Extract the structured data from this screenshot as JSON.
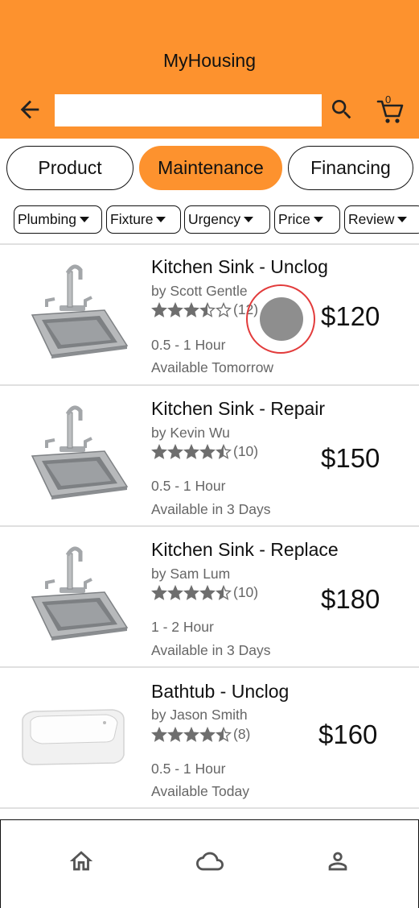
{
  "app": {
    "title": "MyHousing"
  },
  "search": {
    "value": "",
    "placeholder": ""
  },
  "cart": {
    "count": "0"
  },
  "tabs": [
    {
      "label": "Product",
      "active": false
    },
    {
      "label": "Maintenance",
      "active": true
    },
    {
      "label": "Financing",
      "active": false
    }
  ],
  "filters": [
    {
      "label": "Plumbing"
    },
    {
      "label": "Fixture"
    },
    {
      "label": "Urgency"
    },
    {
      "label": "Price"
    },
    {
      "label": "Review"
    }
  ],
  "items": [
    {
      "title": "Kitchen Sink - Unclog",
      "by": "by Scott Gentle",
      "rating": 3.5,
      "reviews": "(12)",
      "duration": "0.5 - 1 Hour",
      "availability": "Available Tomorrow",
      "price": "$120",
      "image": "kitchen-sink"
    },
    {
      "title": "Kitchen Sink - Repair",
      "by": "by Kevin Wu",
      "rating": 4.5,
      "reviews": "(10)",
      "duration": "0.5 - 1 Hour",
      "availability": "Available in 3 Days",
      "price": "$150",
      "image": "kitchen-sink"
    },
    {
      "title": "Kitchen Sink - Replace",
      "by": "by Sam Lum",
      "rating": 4.5,
      "reviews": "(10)",
      "duration": "1 - 2 Hour",
      "availability": "Available in 3 Days",
      "price": "$180",
      "image": "kitchen-sink"
    },
    {
      "title": "Bathtub - Unclog",
      "by": "by Jason Smith",
      "rating": 4.5,
      "reviews": "(8)",
      "duration": "0.5 - 1 Hour",
      "availability": "Available Today",
      "price": "$160",
      "image": "bathtub"
    }
  ],
  "icons": {
    "back": "arrow-back-icon",
    "search": "search-icon",
    "cart": "cart-icon",
    "home": "home-icon",
    "cloud": "cloud-icon",
    "profile": "person-icon"
  },
  "colors": {
    "accent": "#fd922e",
    "touch_ring": "#e23b3b"
  }
}
